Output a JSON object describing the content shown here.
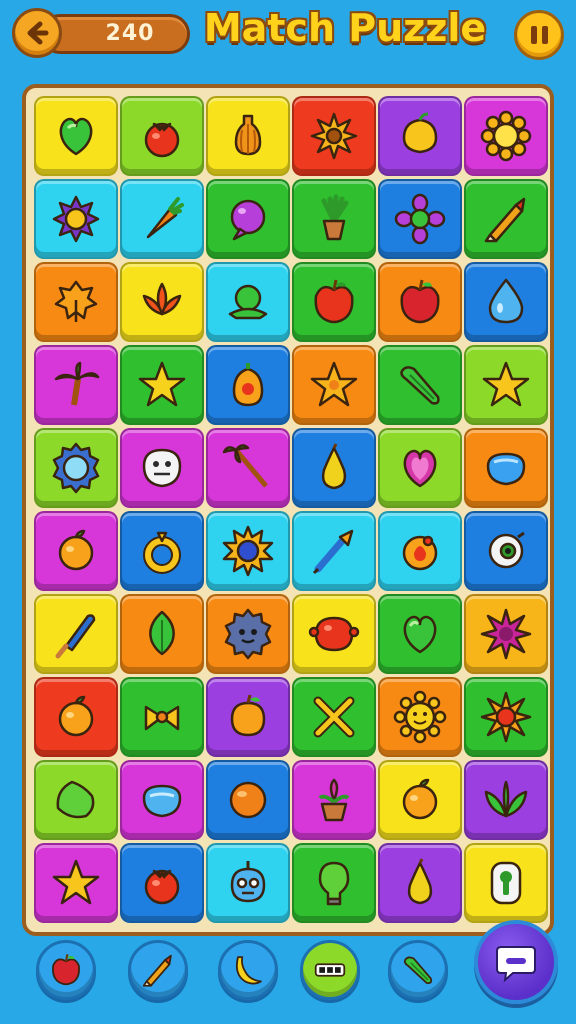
{
  "header": {
    "score": "240",
    "title": "Match Puzzle"
  },
  "colors": {
    "yellow": "#f7e21c",
    "lime": "#8cd92a",
    "green": "#2fbf2f",
    "red": "#ee3a1e",
    "orange": "#f78a12",
    "purple": "#9b3fe0",
    "magenta": "#d737d9",
    "cyan": "#2fd3f0",
    "blue": "#1e7fe0",
    "amber": "#f7b51a"
  },
  "board": {
    "rows": [
      [
        {
          "color": "yellow",
          "icon": "leaf-heart"
        },
        {
          "color": "lime",
          "icon": "tomato"
        },
        {
          "color": "yellow",
          "icon": "gourd"
        },
        {
          "color": "red",
          "icon": "sunflower"
        },
        {
          "color": "purple",
          "icon": "lemon"
        },
        {
          "color": "magenta",
          "icon": "sun-flower"
        }
      ],
      [
        {
          "color": "cyan",
          "icon": "violet-flower"
        },
        {
          "color": "cyan",
          "icon": "carrot"
        },
        {
          "color": "green",
          "icon": "purple-balloon"
        },
        {
          "color": "green",
          "icon": "potted-plant"
        },
        {
          "color": "blue",
          "icon": "purple-flower"
        },
        {
          "color": "green",
          "icon": "crayon"
        }
      ],
      [
        {
          "color": "orange",
          "icon": "autumn-leaf"
        },
        {
          "color": "yellow",
          "icon": "lotus"
        },
        {
          "color": "cyan",
          "icon": "green-dome"
        },
        {
          "color": "green",
          "icon": "red-apple"
        },
        {
          "color": "orange",
          "icon": "apple"
        },
        {
          "color": "blue",
          "icon": "water-drop"
        }
      ],
      [
        {
          "color": "magenta",
          "icon": "palm-tree"
        },
        {
          "color": "green",
          "icon": "star-shell"
        },
        {
          "color": "blue",
          "icon": "bell-pepper"
        },
        {
          "color": "orange",
          "icon": "starfish"
        },
        {
          "color": "green",
          "icon": "okra"
        },
        {
          "color": "lime",
          "icon": "star"
        }
      ],
      [
        {
          "color": "lime",
          "icon": "gear-gem"
        },
        {
          "color": "magenta",
          "icon": "mushroom-face"
        },
        {
          "color": "magenta",
          "icon": "palm-wand"
        },
        {
          "color": "blue",
          "icon": "pear"
        },
        {
          "color": "lime",
          "icon": "heart-gem"
        },
        {
          "color": "orange",
          "icon": "blue-gem"
        }
      ],
      [
        {
          "color": "magenta",
          "icon": "orange-fruit"
        },
        {
          "color": "blue",
          "icon": "gold-ring"
        },
        {
          "color": "cyan",
          "icon": "sun-disc"
        },
        {
          "color": "cyan",
          "icon": "paintbrush"
        },
        {
          "color": "cyan",
          "icon": "fire-orb"
        },
        {
          "color": "blue",
          "icon": "eye-orb"
        }
      ],
      [
        {
          "color": "yellow",
          "icon": "popsicle"
        },
        {
          "color": "orange",
          "icon": "green-leaf"
        },
        {
          "color": "orange",
          "icon": "gear-face"
        },
        {
          "color": "yellow",
          "icon": "red-blob"
        },
        {
          "color": "green",
          "icon": "green-heart"
        },
        {
          "color": "amber",
          "icon": "spiky-flower"
        }
      ],
      [
        {
          "color": "red",
          "icon": "orange-fruit"
        },
        {
          "color": "green",
          "icon": "bow-candy"
        },
        {
          "color": "purple",
          "icon": "peach"
        },
        {
          "color": "green",
          "icon": "cross-sticks"
        },
        {
          "color": "orange",
          "icon": "smiling-sun"
        },
        {
          "color": "green",
          "icon": "red-flower"
        }
      ],
      [
        {
          "color": "lime",
          "icon": "leaf-blob"
        },
        {
          "color": "magenta",
          "icon": "blue-shell"
        },
        {
          "color": "blue",
          "icon": "orange-ball"
        },
        {
          "color": "magenta",
          "icon": "potted-flower"
        },
        {
          "color": "yellow",
          "icon": "orange-fruit"
        },
        {
          "color": "purple",
          "icon": "green-sprout"
        }
      ],
      [
        {
          "color": "magenta",
          "icon": "star"
        },
        {
          "color": "blue",
          "icon": "tomato"
        },
        {
          "color": "cyan",
          "icon": "blob-face"
        },
        {
          "color": "green",
          "icon": "light-bulb"
        },
        {
          "color": "purple",
          "icon": "pear"
        },
        {
          "color": "yellow",
          "icon": "keyhole"
        }
      ]
    ]
  },
  "powerups": [
    {
      "name": "apple",
      "bg": "#2fa3ec"
    },
    {
      "name": "crayon",
      "bg": "#2fa3ec"
    },
    {
      "name": "banana",
      "bg": "#2fa3ec"
    },
    {
      "name": "three-dots",
      "bg": "#8cd92a"
    },
    {
      "name": "okra",
      "bg": "#2fa3ec"
    }
  ]
}
